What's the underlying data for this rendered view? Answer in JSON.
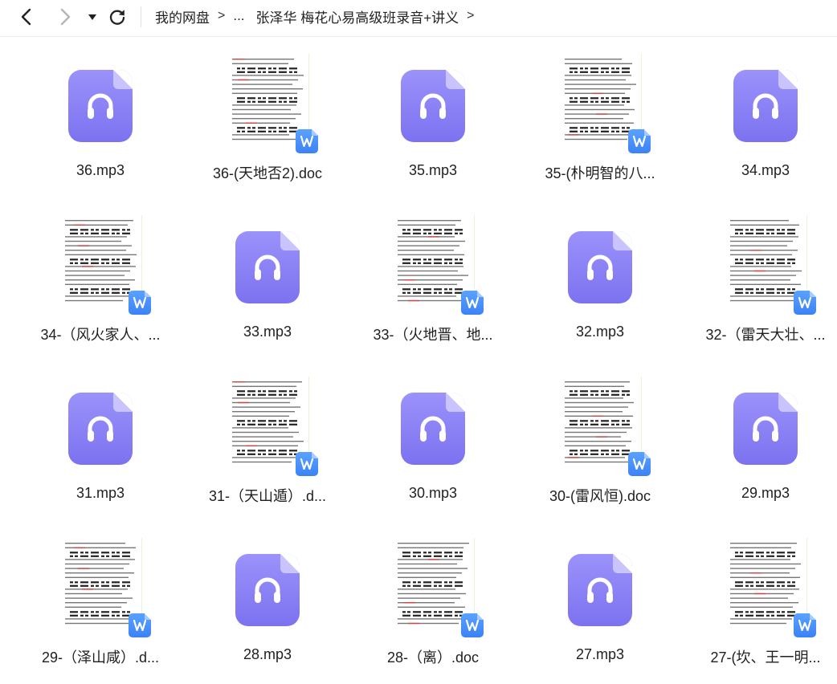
{
  "breadcrumb": {
    "root": "我的网盘",
    "ellipsis": "...",
    "current": "张泽华 梅花心易高级班录音+讲义"
  },
  "files": [
    {
      "name": "36.mp3",
      "type": "audio"
    },
    {
      "name": "36-(天地否2).doc",
      "type": "doc"
    },
    {
      "name": "35.mp3",
      "type": "audio"
    },
    {
      "name": "35-(朴明智的八...",
      "type": "doc"
    },
    {
      "name": "34.mp3",
      "type": "audio"
    },
    {
      "name": "34-（风火家人、...",
      "type": "doc"
    },
    {
      "name": "33.mp3",
      "type": "audio"
    },
    {
      "name": "33-（火地晋、地...",
      "type": "doc"
    },
    {
      "name": "32.mp3",
      "type": "audio"
    },
    {
      "name": "32-（雷天大壮、...",
      "type": "doc"
    },
    {
      "name": "31.mp3",
      "type": "audio"
    },
    {
      "name": "31-（天山遁）.d...",
      "type": "doc"
    },
    {
      "name": "30.mp3",
      "type": "audio"
    },
    {
      "name": "30-(雷风恒).doc",
      "type": "doc"
    },
    {
      "name": "29.mp3",
      "type": "audio"
    },
    {
      "name": "29-（泽山咸）.d...",
      "type": "doc"
    },
    {
      "name": "28.mp3",
      "type": "audio"
    },
    {
      "name": "28-（离）.doc",
      "type": "doc"
    },
    {
      "name": "27.mp3",
      "type": "audio"
    },
    {
      "name": "27-(坎、王一明...",
      "type": "doc"
    }
  ],
  "icons": {
    "audio": "headphones-icon",
    "doc": "word-doc-icon",
    "doc_badge_letter": "W"
  },
  "colors": {
    "audio_tile": "#8a80f6",
    "word_badge": "#3b82f6"
  }
}
